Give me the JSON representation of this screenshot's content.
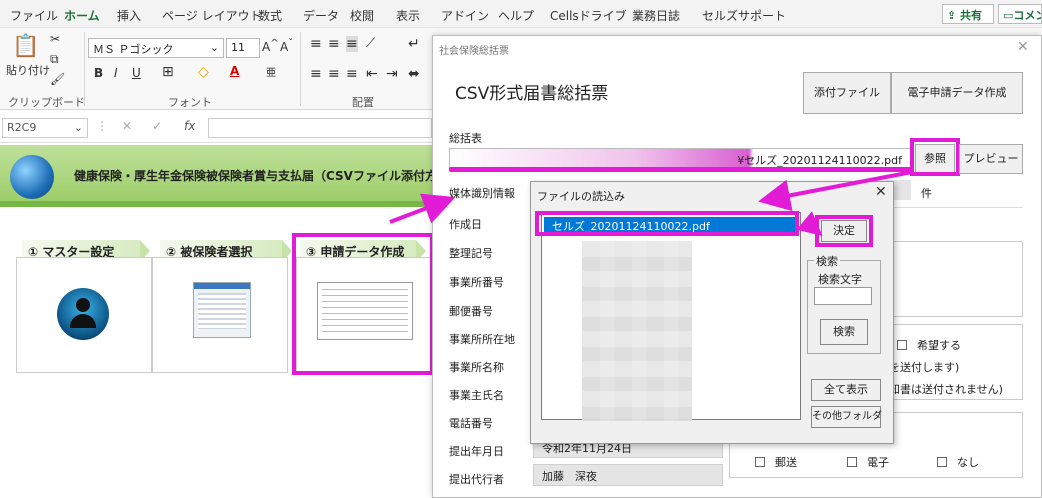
{
  "ribbon": {
    "tabs": [
      "ファイル",
      "ホーム",
      "挿入",
      "ページ レイアウト",
      "数式",
      "データ",
      "校閲",
      "表示",
      "アドイン",
      "ヘルプ",
      "Cellsドライブ",
      "業務日誌",
      "セルズサポート"
    ],
    "share_label": "共有",
    "comment_label": "コメン",
    "paste_label": "貼り付け",
    "font_name": "ＭＳ Ｐゴシック",
    "font_size": "11",
    "group_clipboard": "クリップボード",
    "group_font": "フォント",
    "group_align": "配置"
  },
  "formula_bar": {
    "name_box": "R2C9",
    "fx": "fx"
  },
  "banner": {
    "title": "健康保険・厚生年金保険被保険者賞与支払届（CSVファイル添付方式"
  },
  "steps": [
    {
      "label": "① マスター設定"
    },
    {
      "label": "② 被保険者選択"
    },
    {
      "label": "③ 申請データ作成"
    }
  ],
  "dialog": {
    "window_title": "社会保険総括票",
    "heading": "CSV形式届書総括票",
    "attach_button": "添付ファイル",
    "e_apply_button": "電子申請データ作成",
    "summary_label": "総括表",
    "summary_path": "¥セルズ_20201124110022.pdf",
    "ref_button": "参照",
    "preview_button": "プレビュー",
    "media_label": "媒体識別情報",
    "count_unit": "件",
    "fields": [
      "作成日",
      "整理記号",
      "事業所番号",
      "郵便番号",
      "事業所所在地",
      "事業所名称",
      "事業主氏名",
      "電話番号",
      "提出年月日",
      "提出代行者"
    ],
    "submit_date": "令和2年11月24日",
    "agent_name": "加藤　深夜",
    "hope_label": "希望する",
    "send_note1": "を送付します)",
    "send_note2": "知書は送付されません)",
    "options": [
      "郵送",
      "電子",
      "なし"
    ]
  },
  "file_dialog": {
    "title": "ファイルの読込み",
    "selected_file": "セルズ_20201124110022.pdf",
    "ok_button": "決定",
    "search_group": "検索",
    "search_text_label": "検索文字",
    "search_value": "",
    "search_button": "検索",
    "show_all_button": "全て表示",
    "other_folder_button": "その他フォルダ"
  },
  "colors": {
    "highlight": "#e11bd6",
    "excel_green": "#1e6f3a",
    "selection": "#0078d7"
  }
}
